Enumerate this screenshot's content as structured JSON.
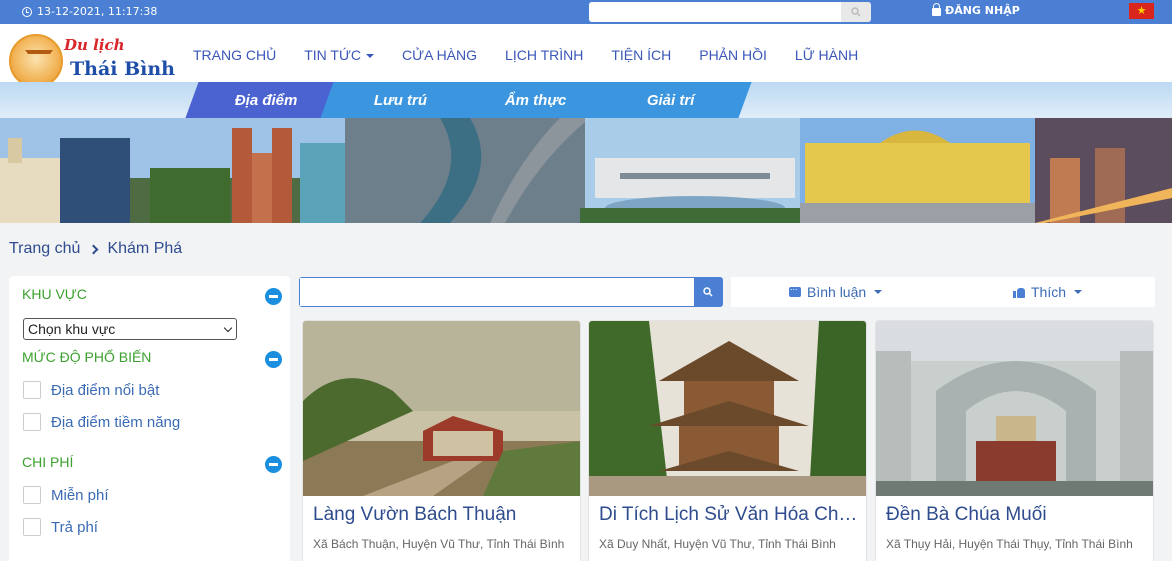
{
  "topbar": {
    "datetime": "13-12-2021, 11:17:38",
    "search_placeholder": "",
    "login_label": "ĐĂNG NHẬP",
    "flag_symbol": "★"
  },
  "logo": {
    "line1": "Du lịch",
    "line2": "Thái Bình"
  },
  "nav": {
    "items": [
      "TRANG CHỦ",
      "TIN TỨC",
      "CỬA HÀNG",
      "LỊCH TRÌNH",
      "TIỆN ÍCH",
      "PHẢN HỒI",
      "LỮ HÀNH"
    ]
  },
  "banner_tabs": [
    "Địa điểm",
    "Lưu trú",
    "Ẩm thực",
    "Giải trí"
  ],
  "breadcrumb": {
    "home": "Trang chủ",
    "current": "Khám Phá"
  },
  "sidebar": {
    "region": {
      "title": "KHU VỰC",
      "select_value": "Chọn khu vực"
    },
    "popularity": {
      "title": "MỨC ĐỘ PHỔ BIẾN",
      "options": [
        "Địa điểm nổi bật",
        "Địa điểm tiềm năng"
      ]
    },
    "cost": {
      "title": "CHI PHÍ",
      "options": [
        "Miễn phí",
        "Trả phí"
      ]
    }
  },
  "search": {
    "placeholder": ""
  },
  "filters": {
    "comment": "Bình luận",
    "like": "Thích"
  },
  "cards": [
    {
      "title": "Làng Vườn Bách Thuận",
      "address": "Xã Bách Thuận, Huyện Vũ Thư, Tỉnh Thái Bình"
    },
    {
      "title": "Di Tích Lịch Sử Văn Hóa Chùa Keo",
      "address": "Xã Duy Nhất, Huyện Vũ Thư, Tỉnh Thái Bình"
    },
    {
      "title": "Đền Bà Chúa Muối",
      "address": "Xã Thụy Hải, Huyện Thái Thụy, Tỉnh Thái Bình"
    }
  ],
  "colors": {
    "primary": "#4a7fd4",
    "green": "#3ca12e",
    "link": "#2e4c8e"
  }
}
